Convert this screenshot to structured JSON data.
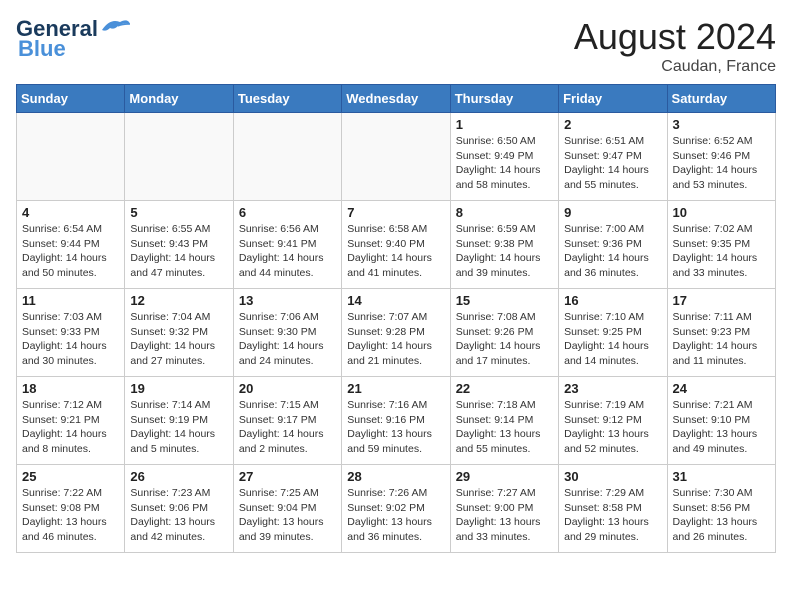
{
  "header": {
    "logo_line1": "General",
    "logo_line2": "Blue",
    "month": "August 2024",
    "location": "Caudan, France"
  },
  "weekdays": [
    "Sunday",
    "Monday",
    "Tuesday",
    "Wednesday",
    "Thursday",
    "Friday",
    "Saturday"
  ],
  "weeks": [
    [
      {
        "day": "",
        "info": "",
        "empty": true
      },
      {
        "day": "",
        "info": "",
        "empty": true
      },
      {
        "day": "",
        "info": "",
        "empty": true
      },
      {
        "day": "",
        "info": "",
        "empty": true
      },
      {
        "day": "1",
        "info": "Sunrise: 6:50 AM\nSunset: 9:49 PM\nDaylight: 14 hours\nand 58 minutes."
      },
      {
        "day": "2",
        "info": "Sunrise: 6:51 AM\nSunset: 9:47 PM\nDaylight: 14 hours\nand 55 minutes."
      },
      {
        "day": "3",
        "info": "Sunrise: 6:52 AM\nSunset: 9:46 PM\nDaylight: 14 hours\nand 53 minutes."
      }
    ],
    [
      {
        "day": "4",
        "info": "Sunrise: 6:54 AM\nSunset: 9:44 PM\nDaylight: 14 hours\nand 50 minutes."
      },
      {
        "day": "5",
        "info": "Sunrise: 6:55 AM\nSunset: 9:43 PM\nDaylight: 14 hours\nand 47 minutes."
      },
      {
        "day": "6",
        "info": "Sunrise: 6:56 AM\nSunset: 9:41 PM\nDaylight: 14 hours\nand 44 minutes."
      },
      {
        "day": "7",
        "info": "Sunrise: 6:58 AM\nSunset: 9:40 PM\nDaylight: 14 hours\nand 41 minutes."
      },
      {
        "day": "8",
        "info": "Sunrise: 6:59 AM\nSunset: 9:38 PM\nDaylight: 14 hours\nand 39 minutes."
      },
      {
        "day": "9",
        "info": "Sunrise: 7:00 AM\nSunset: 9:36 PM\nDaylight: 14 hours\nand 36 minutes."
      },
      {
        "day": "10",
        "info": "Sunrise: 7:02 AM\nSunset: 9:35 PM\nDaylight: 14 hours\nand 33 minutes."
      }
    ],
    [
      {
        "day": "11",
        "info": "Sunrise: 7:03 AM\nSunset: 9:33 PM\nDaylight: 14 hours\nand 30 minutes."
      },
      {
        "day": "12",
        "info": "Sunrise: 7:04 AM\nSunset: 9:32 PM\nDaylight: 14 hours\nand 27 minutes."
      },
      {
        "day": "13",
        "info": "Sunrise: 7:06 AM\nSunset: 9:30 PM\nDaylight: 14 hours\nand 24 minutes."
      },
      {
        "day": "14",
        "info": "Sunrise: 7:07 AM\nSunset: 9:28 PM\nDaylight: 14 hours\nand 21 minutes."
      },
      {
        "day": "15",
        "info": "Sunrise: 7:08 AM\nSunset: 9:26 PM\nDaylight: 14 hours\nand 17 minutes."
      },
      {
        "day": "16",
        "info": "Sunrise: 7:10 AM\nSunset: 9:25 PM\nDaylight: 14 hours\nand 14 minutes."
      },
      {
        "day": "17",
        "info": "Sunrise: 7:11 AM\nSunset: 9:23 PM\nDaylight: 14 hours\nand 11 minutes."
      }
    ],
    [
      {
        "day": "18",
        "info": "Sunrise: 7:12 AM\nSunset: 9:21 PM\nDaylight: 14 hours\nand 8 minutes."
      },
      {
        "day": "19",
        "info": "Sunrise: 7:14 AM\nSunset: 9:19 PM\nDaylight: 14 hours\nand 5 minutes."
      },
      {
        "day": "20",
        "info": "Sunrise: 7:15 AM\nSunset: 9:17 PM\nDaylight: 14 hours\nand 2 minutes."
      },
      {
        "day": "21",
        "info": "Sunrise: 7:16 AM\nSunset: 9:16 PM\nDaylight: 13 hours\nand 59 minutes."
      },
      {
        "day": "22",
        "info": "Sunrise: 7:18 AM\nSunset: 9:14 PM\nDaylight: 13 hours\nand 55 minutes."
      },
      {
        "day": "23",
        "info": "Sunrise: 7:19 AM\nSunset: 9:12 PM\nDaylight: 13 hours\nand 52 minutes."
      },
      {
        "day": "24",
        "info": "Sunrise: 7:21 AM\nSunset: 9:10 PM\nDaylight: 13 hours\nand 49 minutes."
      }
    ],
    [
      {
        "day": "25",
        "info": "Sunrise: 7:22 AM\nSunset: 9:08 PM\nDaylight: 13 hours\nand 46 minutes."
      },
      {
        "day": "26",
        "info": "Sunrise: 7:23 AM\nSunset: 9:06 PM\nDaylight: 13 hours\nand 42 minutes."
      },
      {
        "day": "27",
        "info": "Sunrise: 7:25 AM\nSunset: 9:04 PM\nDaylight: 13 hours\nand 39 minutes."
      },
      {
        "day": "28",
        "info": "Sunrise: 7:26 AM\nSunset: 9:02 PM\nDaylight: 13 hours\nand 36 minutes."
      },
      {
        "day": "29",
        "info": "Sunrise: 7:27 AM\nSunset: 9:00 PM\nDaylight: 13 hours\nand 33 minutes."
      },
      {
        "day": "30",
        "info": "Sunrise: 7:29 AM\nSunset: 8:58 PM\nDaylight: 13 hours\nand 29 minutes."
      },
      {
        "day": "31",
        "info": "Sunrise: 7:30 AM\nSunset: 8:56 PM\nDaylight: 13 hours\nand 26 minutes."
      }
    ]
  ]
}
